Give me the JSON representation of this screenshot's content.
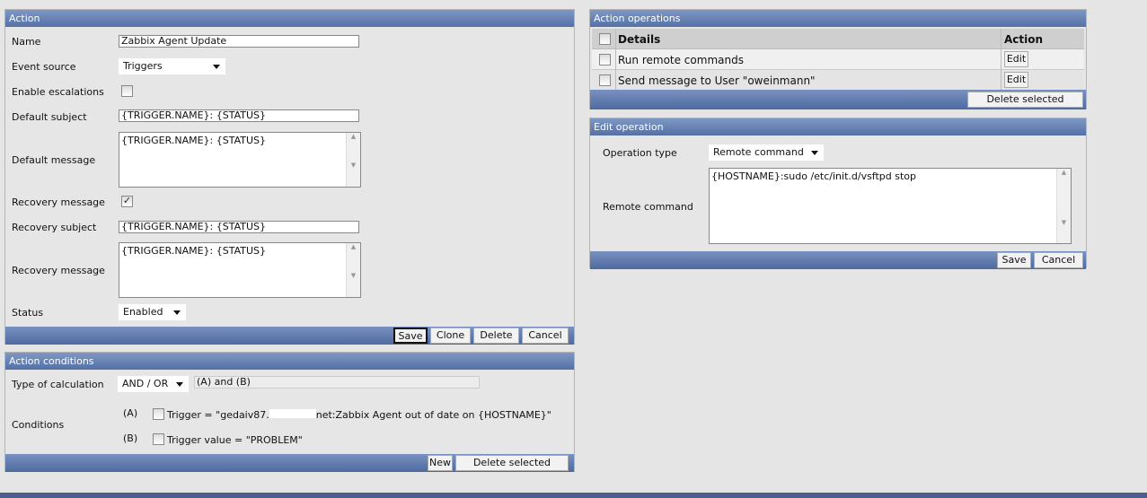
{
  "action": {
    "title": "Action",
    "fields": {
      "name_label": "Name",
      "name_value": "Zabbix Agent Update",
      "event_source_label": "Event source",
      "event_source_value": "Triggers",
      "enable_escalations_label": "Enable escalations",
      "enable_escalations_checked": false,
      "default_subject_label": "Default subject",
      "default_subject_value": "{TRIGGER.NAME}: {STATUS}",
      "default_message_label": "Default message",
      "default_message_value": "{TRIGGER.NAME}: {STATUS}",
      "recovery_message_checkbox_label": "Recovery message",
      "recovery_message_checked": true,
      "recovery_subject_label": "Recovery subject",
      "recovery_subject_value": "{TRIGGER.NAME}: {STATUS}",
      "recovery_message_label": "Recovery message",
      "recovery_message_value": "{TRIGGER.NAME}: {STATUS}",
      "status_label": "Status",
      "status_value": "Enabled"
    },
    "buttons": {
      "save": "Save",
      "clone": "Clone",
      "delete": "Delete",
      "cancel": "Cancel"
    }
  },
  "conditions": {
    "title": "Action conditions",
    "calc_label": "Type of calculation",
    "calc_value": "AND / OR",
    "calc_formula": "(A) and (B)",
    "conditions_label": "Conditions",
    "items": [
      {
        "tag": "(A)",
        "text_before": "Trigger = \"gedaiv87.",
        "text_after": "net:Zabbix Agent out of date on {HOSTNAME}\""
      },
      {
        "tag": "(B)",
        "text": "Trigger value = \"PROBLEM\""
      }
    ],
    "buttons": {
      "new": "New",
      "delete_selected": "Delete selected"
    }
  },
  "operations": {
    "title": "Action operations",
    "columns": [
      "Details",
      "Action"
    ],
    "rows": [
      {
        "details": "Run remote commands",
        "action": "Edit"
      },
      {
        "details": "Send message to User \"oweinmann\"",
        "action": "Edit"
      }
    ],
    "delete_selected": "Delete selected"
  },
  "edit_operation": {
    "title": "Edit operation",
    "type_label": "Operation type",
    "type_value": "Remote command",
    "command_label": "Remote command",
    "command_value": "{HOSTNAME}:sudo /etc/init.d/vsftpd stop",
    "buttons": {
      "save": "Save",
      "cancel": "Cancel"
    }
  }
}
